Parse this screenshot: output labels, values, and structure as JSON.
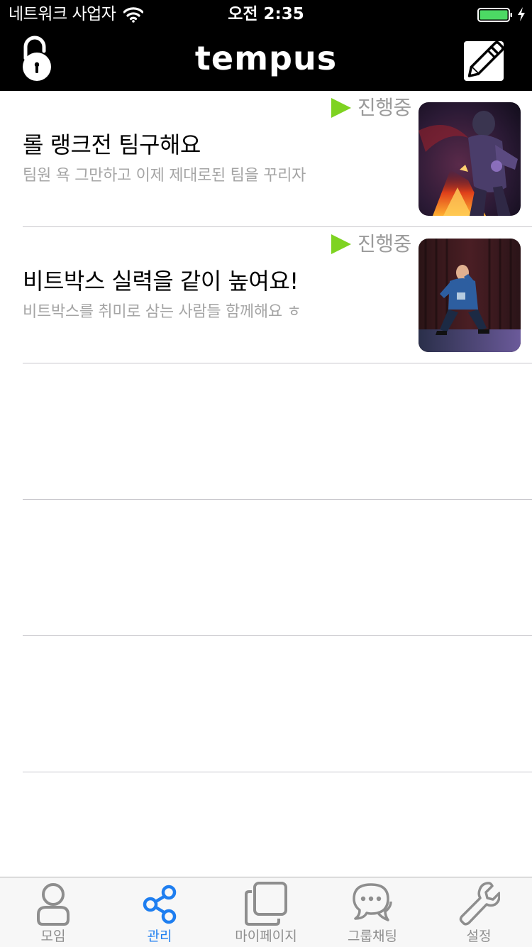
{
  "status_bar": {
    "carrier": "네트워크 사업자",
    "time": "오전 2:35",
    "icons": [
      "wifi-icon",
      "battery-icon",
      "charging-bolt-icon"
    ]
  },
  "nav": {
    "title": "tempus",
    "left_icon": "unlock-icon",
    "right_icon": "compose-icon"
  },
  "rooms": [
    {
      "status": "진행중",
      "title": "롤 랭크전 팀구해요",
      "subtitle": "팀원 욕 그만하고 이제 제대로된 팀을 꾸리자",
      "thumbnail": "game-character-thumbnail"
    },
    {
      "status": "진행중",
      "title": "비트박스 실력을 같이 높여요!",
      "subtitle": "비트박스를 취미로 삼는 사람들 함께해요 ㅎ",
      "thumbnail": "beatbox-performer-thumbnail"
    }
  ],
  "tabs": [
    {
      "label": "모임",
      "icon": "person-icon",
      "active": false
    },
    {
      "label": "관리",
      "icon": "share-icon",
      "active": true
    },
    {
      "label": "마이페이지",
      "icon": "stacked-squares-icon",
      "active": false
    },
    {
      "label": "그룹채팅",
      "icon": "chat-bubbles-icon",
      "active": false
    },
    {
      "label": "설정",
      "icon": "wrench-icon",
      "active": false
    }
  ],
  "colors": {
    "header_bg": "#000000",
    "status_green": "#7ed321",
    "active_tab": "#1e7ef0",
    "inactive_tab": "#8e8e8e",
    "battery_green": "#4cd964"
  }
}
